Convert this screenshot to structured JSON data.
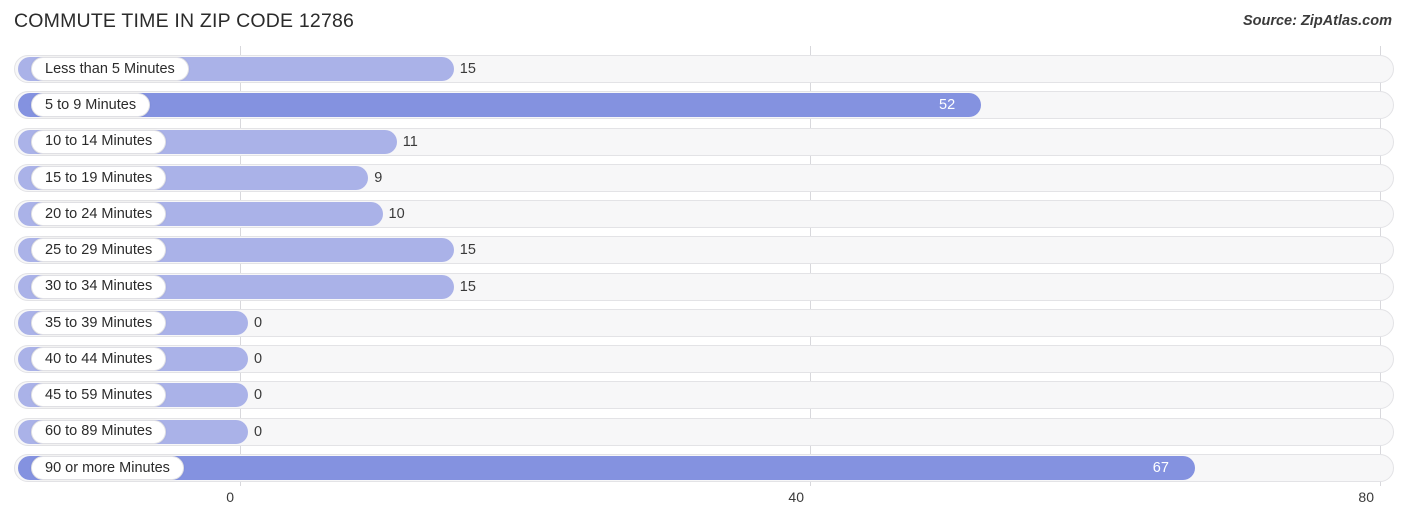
{
  "header": {
    "title": "COMMUTE TIME IN ZIP CODE 12786",
    "source": "Source: ZipAtlas.com"
  },
  "colors": {
    "bar_light": "#aab2e8",
    "bar_dark": "#8492e0",
    "track": "#f7f7f8",
    "gridline": "#d8d8dc",
    "text": "#2b2b2b",
    "value_inside": "#ffffff"
  },
  "chart_data": {
    "type": "bar",
    "orientation": "horizontal",
    "title": "COMMUTE TIME IN ZIP CODE 12786",
    "xlabel": "",
    "ylabel": "",
    "xlim": [
      0,
      80
    ],
    "xticks": [
      "0",
      "40",
      "80"
    ],
    "xtick_values": [
      0,
      40,
      80
    ],
    "grid": true,
    "legend": false,
    "categories": [
      "Less than 5 Minutes",
      "5 to 9 Minutes",
      "10 to 14 Minutes",
      "15 to 19 Minutes",
      "20 to 24 Minutes",
      "25 to 29 Minutes",
      "30 to 34 Minutes",
      "35 to 39 Minutes",
      "40 to 44 Minutes",
      "45 to 59 Minutes",
      "60 to 89 Minutes",
      "90 or more Minutes"
    ],
    "values": [
      15,
      52,
      11,
      9,
      10,
      15,
      15,
      0,
      0,
      0,
      0,
      67
    ],
    "value_labels": [
      "15",
      "52",
      "11",
      "9",
      "10",
      "15",
      "15",
      "0",
      "0",
      "0",
      "0",
      "67"
    ]
  },
  "rows": [
    {
      "label": "Less than 5 Minutes",
      "value": 15,
      "value_label": "15",
      "inside": false,
      "dark": false
    },
    {
      "label": "5 to 9 Minutes",
      "value": 52,
      "value_label": "52",
      "inside": true,
      "dark": true
    },
    {
      "label": "10 to 14 Minutes",
      "value": 11,
      "value_label": "11",
      "inside": false,
      "dark": false
    },
    {
      "label": "15 to 19 Minutes",
      "value": 9,
      "value_label": "9",
      "inside": false,
      "dark": false
    },
    {
      "label": "20 to 24 Minutes",
      "value": 10,
      "value_label": "10",
      "inside": false,
      "dark": false
    },
    {
      "label": "25 to 29 Minutes",
      "value": 15,
      "value_label": "15",
      "inside": false,
      "dark": false
    },
    {
      "label": "30 to 34 Minutes",
      "value": 15,
      "value_label": "15",
      "inside": false,
      "dark": false
    },
    {
      "label": "35 to 39 Minutes",
      "value": 0,
      "value_label": "0",
      "inside": false,
      "dark": false
    },
    {
      "label": "40 to 44 Minutes",
      "value": 0,
      "value_label": "0",
      "inside": false,
      "dark": false
    },
    {
      "label": "45 to 59 Minutes",
      "value": 0,
      "value_label": "0",
      "inside": false,
      "dark": false
    },
    {
      "label": "60 to 89 Minutes",
      "value": 0,
      "value_label": "0",
      "inside": false,
      "dark": false
    },
    {
      "label": "90 or more Minutes",
      "value": 67,
      "value_label": "67",
      "inside": true,
      "dark": true
    }
  ],
  "axis": {
    "ticks": [
      "0",
      "40",
      "80"
    ]
  }
}
